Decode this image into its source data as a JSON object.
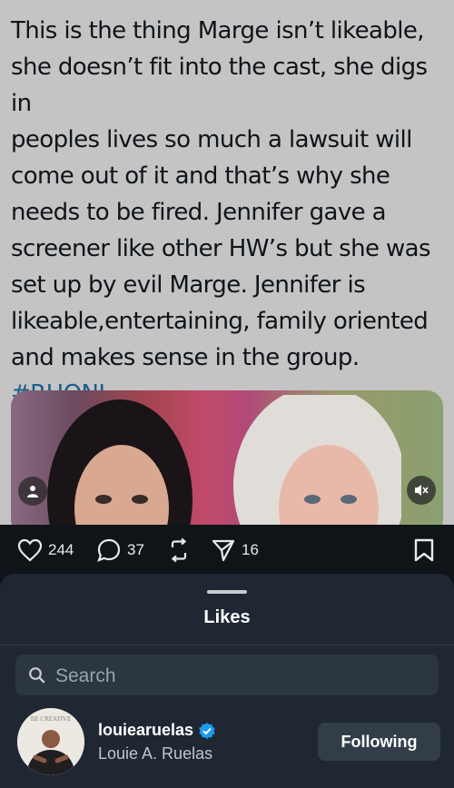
{
  "tweet": {
    "lines": [
      "This is the thing Marge isn’t likeable,",
      "she doesn’t fit into the cast, she digs in",
      "peoples lives so much a lawsuit will",
      "come out of it and that’s why she",
      "needs to be fired. Jennifer gave a",
      "screener like other HW’s but she was",
      "set up by evil Marge. Jennifer is",
      "likeable,entertaining, family oriented",
      "and makes sense in the group."
    ],
    "hashtag": "#RHONJ"
  },
  "actions": {
    "likes": "244",
    "replies": "37",
    "views": "16"
  },
  "sheet": {
    "title": "Likes",
    "search_placeholder": "Search",
    "users": [
      {
        "username": "louiearuelas",
        "display_name": "Louie A. Ruelas",
        "verified": true,
        "button": "Following",
        "avatar_text": "BE CREATIVE"
      }
    ]
  },
  "colors": {
    "hashtag": "#1a5e8a",
    "verified": "#1d9bf0",
    "sheet_bg": "#1e2732"
  }
}
